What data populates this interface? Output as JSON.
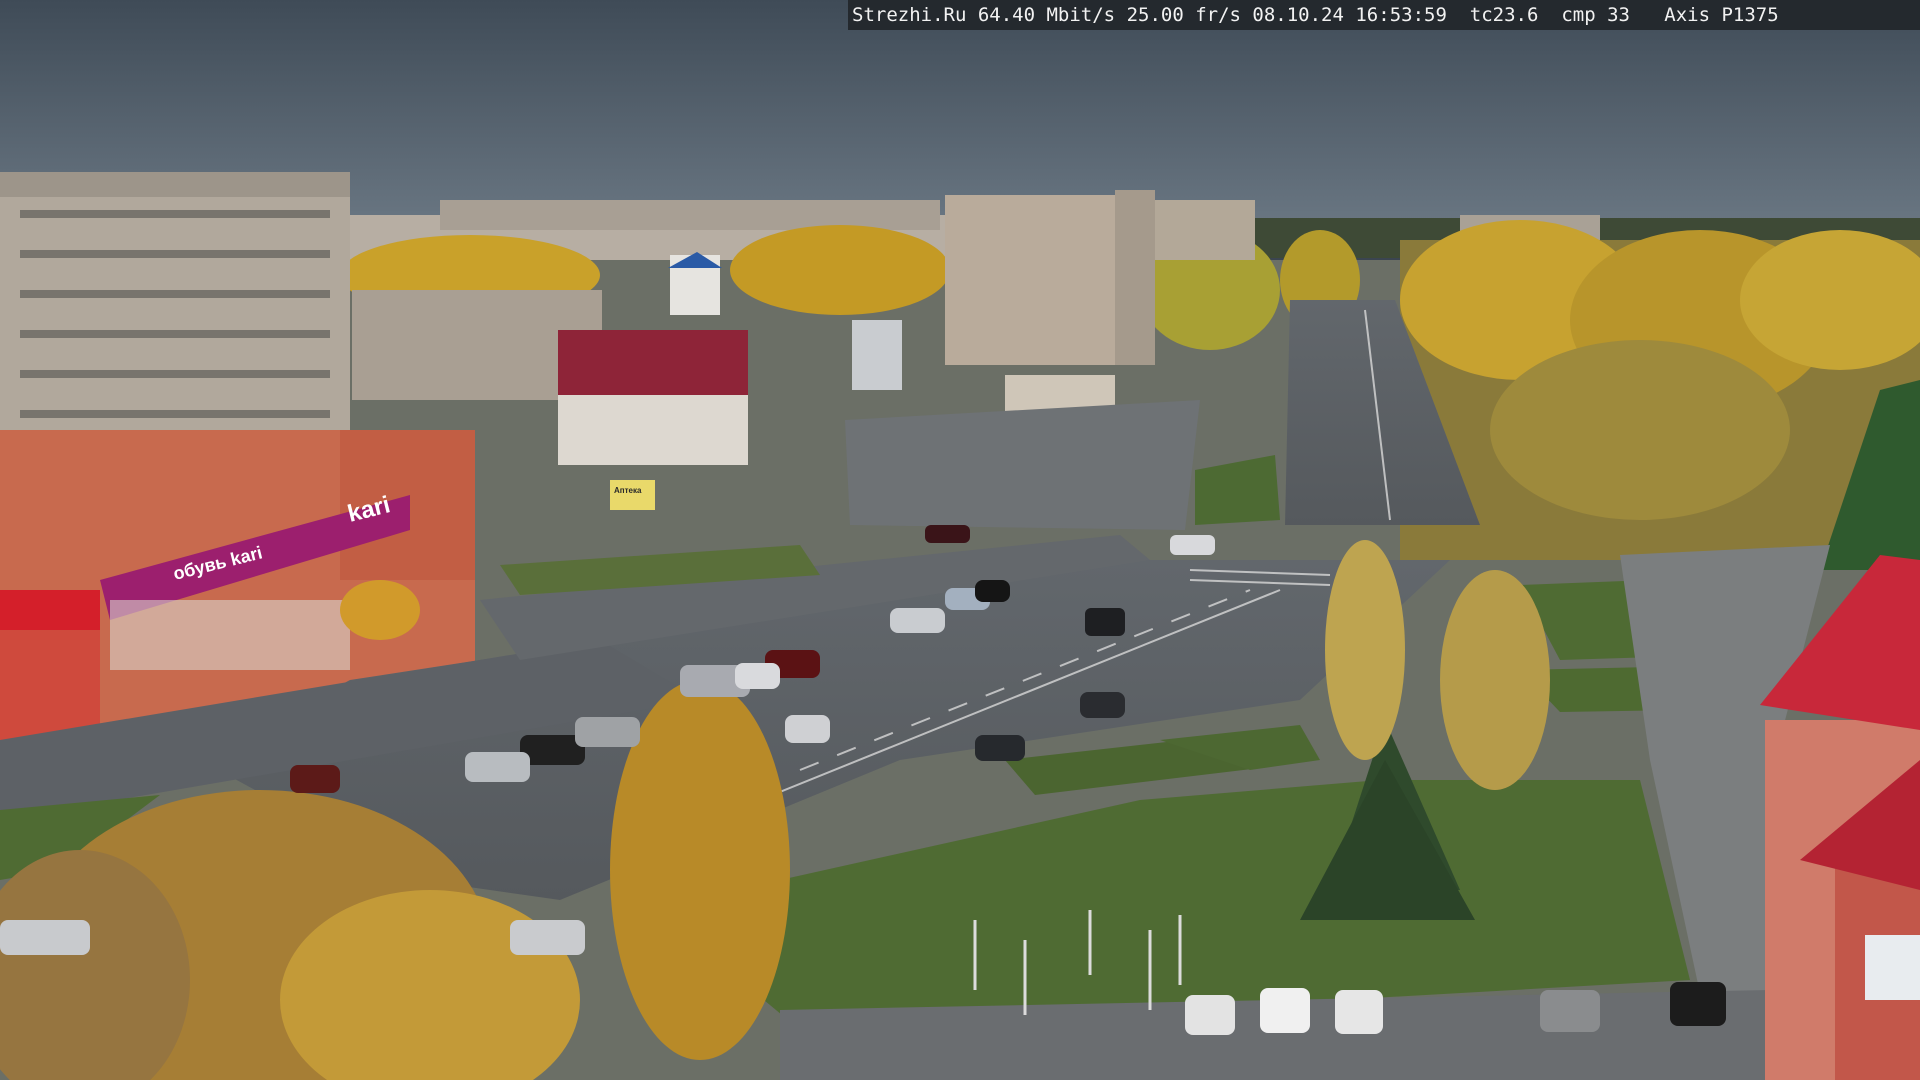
{
  "overlay": {
    "site": "Strezhi.Ru",
    "bitrate": "64.40 Mbit/s",
    "framerate": "25.00 fr/s",
    "datetime": "08.10.24 16:53:59",
    "temperature": "tc23.6",
    "compression": "cmp 33",
    "camera_model": "Axis P1375"
  },
  "signs": {
    "store_logo": "kari",
    "store_banner": "обувь kari",
    "billboard": "Аптека"
  },
  "colors": {
    "sky": "#4a5866",
    "asphalt": "#5c6166",
    "grass": "#4f6b33",
    "autumn_foliage": "#c9a12a",
    "store_magenta": "#9c1f6e",
    "red_roof": "#c8283a"
  }
}
